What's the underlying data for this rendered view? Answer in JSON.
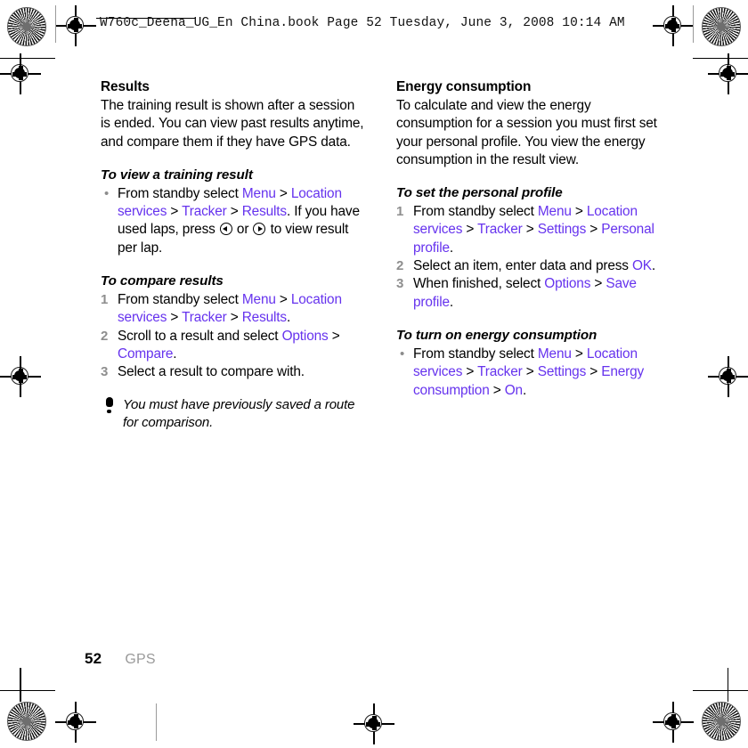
{
  "header": {
    "slug": "W760c_Deena_UG_En China.book  Page 52  Tuesday, June 3, 2008  10:14 AM"
  },
  "left_column": {
    "section_title": "Results",
    "intro": "The training result is shown after a session is ended. You can view past results anytime, and compare them if they have GPS data.",
    "procedures": [
      {
        "title": "To view a training result",
        "type": "bullet",
        "steps": [
          {
            "marker": "•",
            "parts": [
              {
                "text": "From standby select ",
                "style": "plain"
              },
              {
                "text": "Menu",
                "style": "link"
              },
              {
                "text": " > ",
                "style": "plain"
              },
              {
                "text": "Location services",
                "style": "link"
              },
              {
                "text": " > ",
                "style": "plain"
              },
              {
                "text": "Tracker",
                "style": "link"
              },
              {
                "text": " > ",
                "style": "plain"
              },
              {
                "text": "Results",
                "style": "link"
              },
              {
                "text": ". If you have used laps, press ",
                "style": "plain"
              },
              {
                "text": "",
                "style": "navkey-left"
              },
              {
                "text": " or ",
                "style": "plain"
              },
              {
                "text": "",
                "style": "navkey-right"
              },
              {
                "text": " to view result per lap.",
                "style": "plain"
              }
            ]
          }
        ]
      },
      {
        "title": "To compare results",
        "type": "numbered",
        "steps": [
          {
            "marker": "1",
            "parts": [
              {
                "text": "From standby select ",
                "style": "plain"
              },
              {
                "text": "Menu",
                "style": "link"
              },
              {
                "text": " > ",
                "style": "plain"
              },
              {
                "text": "Location services",
                "style": "link"
              },
              {
                "text": " > ",
                "style": "plain"
              },
              {
                "text": "Tracker",
                "style": "link"
              },
              {
                "text": " > ",
                "style": "plain"
              },
              {
                "text": "Results",
                "style": "link"
              },
              {
                "text": ".",
                "style": "plain"
              }
            ]
          },
          {
            "marker": "2",
            "parts": [
              {
                "text": "Scroll to a result and select ",
                "style": "plain"
              },
              {
                "text": "Options",
                "style": "link"
              },
              {
                "text": " > ",
                "style": "plain"
              },
              {
                "text": "Compare",
                "style": "link"
              },
              {
                "text": ".",
                "style": "plain"
              }
            ]
          },
          {
            "marker": "3",
            "parts": [
              {
                "text": "Select a result to compare with.",
                "style": "plain"
              }
            ]
          }
        ]
      }
    ],
    "note": {
      "icon": "exclamation-icon",
      "text": "You must have previously saved a route for comparison."
    }
  },
  "right_column": {
    "section_title": "Energy consumption",
    "intro": "To calculate and view the energy consumption for a session you must first set your personal profile. You view the energy consumption in the result view.",
    "procedures": [
      {
        "title": "To set the personal profile",
        "type": "numbered",
        "steps": [
          {
            "marker": "1",
            "parts": [
              {
                "text": "From standby select ",
                "style": "plain"
              },
              {
                "text": "Menu",
                "style": "link"
              },
              {
                "text": " > ",
                "style": "plain"
              },
              {
                "text": "Location services",
                "style": "link"
              },
              {
                "text": " > ",
                "style": "plain"
              },
              {
                "text": "Tracker",
                "style": "link"
              },
              {
                "text": " > ",
                "style": "plain"
              },
              {
                "text": "Settings",
                "style": "link"
              },
              {
                "text": " > ",
                "style": "plain"
              },
              {
                "text": "Personal profile",
                "style": "link"
              },
              {
                "text": ".",
                "style": "plain"
              }
            ]
          },
          {
            "marker": "2",
            "parts": [
              {
                "text": "Select an item, enter data and press ",
                "style": "plain"
              },
              {
                "text": "OK",
                "style": "link"
              },
              {
                "text": ".",
                "style": "plain"
              }
            ]
          },
          {
            "marker": "3",
            "parts": [
              {
                "text": "When finished, select ",
                "style": "plain"
              },
              {
                "text": "Options",
                "style": "link"
              },
              {
                "text": " > ",
                "style": "plain"
              },
              {
                "text": "Save profile",
                "style": "link"
              },
              {
                "text": ".",
                "style": "plain"
              }
            ]
          }
        ]
      },
      {
        "title": "To turn on energy consumption",
        "type": "bullet",
        "steps": [
          {
            "marker": "•",
            "parts": [
              {
                "text": "From standby select ",
                "style": "plain"
              },
              {
                "text": "Menu",
                "style": "link"
              },
              {
                "text": " > ",
                "style": "plain"
              },
              {
                "text": "Location services",
                "style": "link"
              },
              {
                "text": " > ",
                "style": "plain"
              },
              {
                "text": "Tracker",
                "style": "link"
              },
              {
                "text": " > ",
                "style": "plain"
              },
              {
                "text": "Settings",
                "style": "link"
              },
              {
                "text": " > ",
                "style": "plain"
              },
              {
                "text": "Energy consumption",
                "style": "link"
              },
              {
                "text": " > ",
                "style": "plain"
              },
              {
                "text": "On",
                "style": "link"
              },
              {
                "text": ".",
                "style": "plain"
              }
            ]
          }
        ]
      }
    ]
  },
  "footer": {
    "page_number": "52",
    "chapter": "GPS"
  },
  "colors": {
    "link": "#6633ee",
    "marker_gray": "#8e8e8e",
    "chapter_gray": "#9a9a9a",
    "text": "#000000"
  }
}
